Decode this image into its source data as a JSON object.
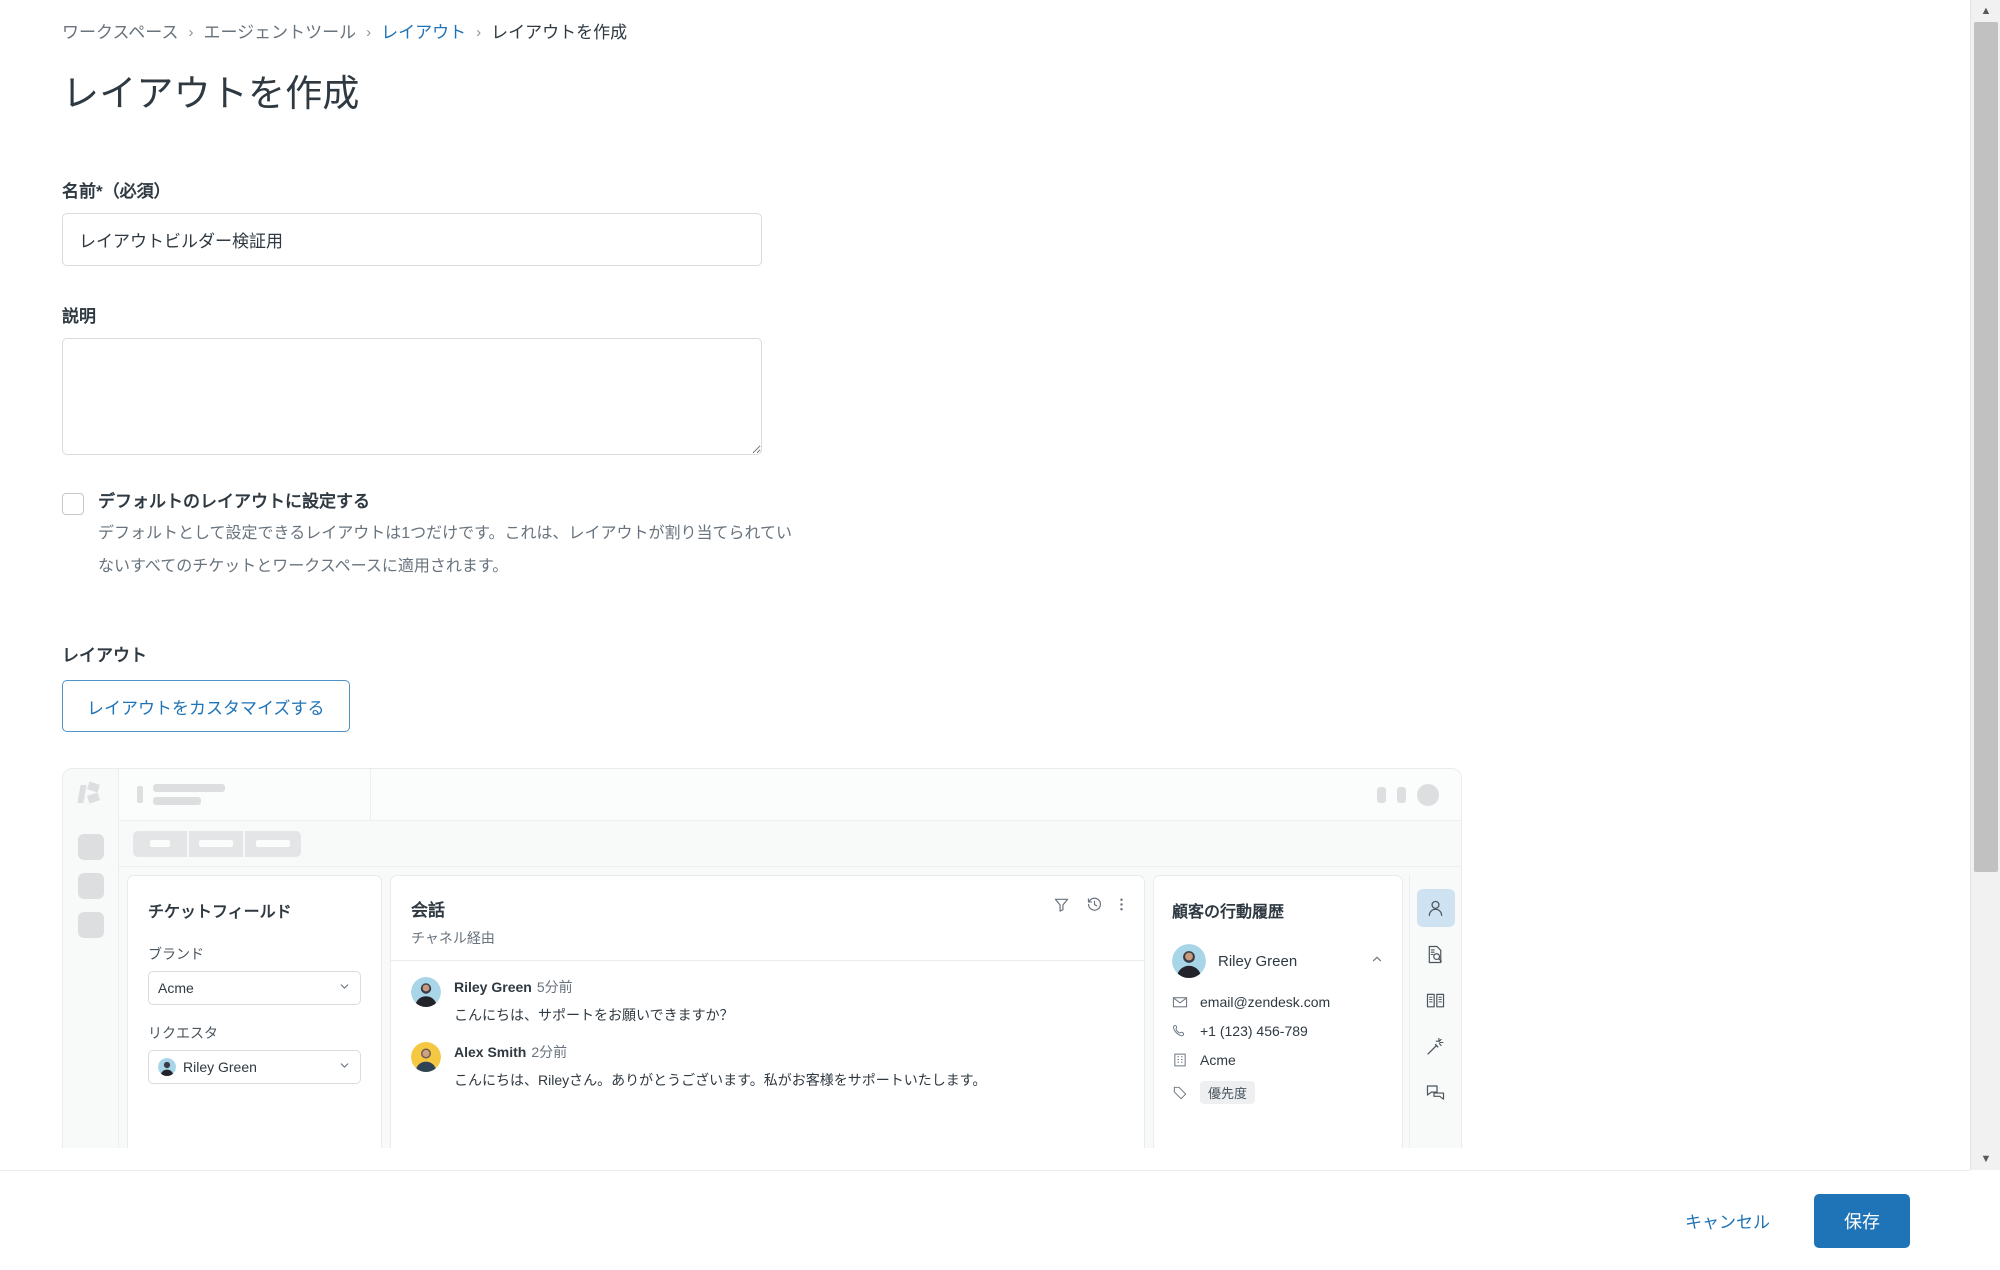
{
  "breadcrumb": {
    "items": [
      {
        "label": "ワークスペース",
        "type": "muted"
      },
      {
        "label": "エージェントツール",
        "type": "muted"
      },
      {
        "label": "レイアウト",
        "type": "link"
      },
      {
        "label": "レイアウトを作成",
        "type": "current"
      }
    ],
    "separator": "›"
  },
  "page": {
    "title": "レイアウトを作成"
  },
  "form": {
    "name": {
      "label": "名前*（必須）",
      "value": "レイアウトビルダー検証用",
      "placeholder": ""
    },
    "description": {
      "label": "説明",
      "value": "",
      "placeholder": ""
    },
    "default_checkbox": {
      "title": "デフォルトのレイアウトに設定する",
      "description": "デフォルトとして設定できるレイアウトは1つだけです。これは、レイアウトが割り当てられていないすべてのチケットとワークスペースに適用されます。",
      "checked": false
    },
    "layout_section": {
      "label": "レイアウト",
      "customize_button": "レイアウトをカスタマイズする"
    }
  },
  "preview": {
    "fields_panel": {
      "title": "チケットフィールド",
      "fields": [
        {
          "label": "ブランド",
          "value": "Acme",
          "has_avatar": false
        },
        {
          "label": "リクエスタ",
          "value": "Riley Green",
          "has_avatar": true
        }
      ],
      "chevron": "⌄"
    },
    "conversation_panel": {
      "title": "会話",
      "subtitle": "チャネル経由",
      "actions": [
        "filter-icon",
        "history-icon",
        "more-icon"
      ],
      "messages": [
        {
          "author": "Riley Green",
          "time": "5分前",
          "text": "こんにちは、サポートをお願いできますか？",
          "avatar_color": "#a8d5e8"
        },
        {
          "author": "Alex Smith",
          "time": "2分前",
          "text": "こんにちは、Rileyさん。ありがとうございます。私がお客様をサポートいたします。",
          "avatar_color": "#f5c842"
        }
      ]
    },
    "customer_panel": {
      "title": "顧客の行動履歴",
      "person": {
        "name": "Riley Green",
        "chevron": "⌃"
      },
      "rows": [
        {
          "icon": "email-icon",
          "value": "email@zendesk.com"
        },
        {
          "icon": "phone-icon",
          "value": "+1 (123) 456-789"
        },
        {
          "icon": "company-icon",
          "value": "Acme"
        },
        {
          "icon": "tag-icon",
          "value": "優先度"
        }
      ]
    },
    "side_icons": [
      {
        "name": "user-icon",
        "active": true
      },
      {
        "name": "document-search-icon",
        "active": false
      },
      {
        "name": "knowledge-book-icon",
        "active": false
      },
      {
        "name": "magic-wand-icon",
        "active": false
      },
      {
        "name": "chat-bubbles-icon",
        "active": false
      }
    ]
  },
  "footer": {
    "cancel_label": "キャンセル",
    "save_label": "保存"
  },
  "colors": {
    "accent": "#1f73b7",
    "link": "#1f73b7",
    "text": "#2f3941",
    "muted": "#68737d",
    "border": "#d8dcde",
    "active_icon_bg": "#cee2f2"
  },
  "scrollbar": {
    "up_arrow": "▲",
    "down_arrow": "▼"
  }
}
